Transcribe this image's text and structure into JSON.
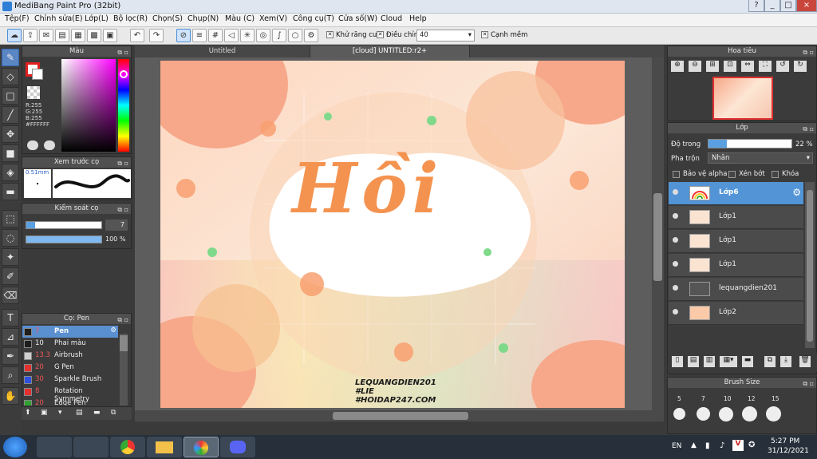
{
  "window": {
    "title": "MediBang Paint Pro (32bit)",
    "controls": [
      "?",
      "_",
      "□",
      "×"
    ]
  },
  "menu": [
    "Tệp(F)",
    "Chỉnh sửa(E)",
    "Lớp(L)",
    "Bộ lọc(R)",
    "Chọn(S)",
    "Chụp(N)",
    "Màu (C)",
    "Xem(V)",
    "Công cụ(T)",
    "Cửa số(W)",
    "Cloud",
    "Help"
  ],
  "toolbar": {
    "antialias_label": "Khử răng cưa",
    "correction_label": "Điều chỉnh",
    "correction_value": "40",
    "sharp_label": "Cạnh mềm"
  },
  "color_panel": {
    "title": "Màu",
    "r": "R:255",
    "g": "G:255",
    "b": "B:255",
    "hex": "#FFFFFF",
    "primary_color": "#e02020",
    "secondary_color": "#ffffff"
  },
  "brush_preview": {
    "title": "Xem trước cọ",
    "size": "0.51mm"
  },
  "brush_control": {
    "title": "Kiểm soát cọ",
    "size_value": "7",
    "opacity_value": "100 %"
  },
  "brush_list": {
    "title": "Cọ: Pen",
    "items": [
      {
        "size": "7",
        "name": "Pen",
        "color": "#1e1e1e"
      },
      {
        "size": "10",
        "name": "Phai màu",
        "color": "#1e1e1e"
      },
      {
        "size": "13.3",
        "name": "Airbrush",
        "color": "#cfcfcf"
      },
      {
        "size": "20",
        "name": "G Pen",
        "color": "#e03030"
      },
      {
        "size": "30",
        "name": "Sparkle Brush",
        "color": "#3050e0"
      },
      {
        "size": "8",
        "name": "Rotation Symmetry",
        "color": "#e03030"
      },
      {
        "size": "20",
        "name": "Edge Pen",
        "color": "#30a030"
      }
    ]
  },
  "tabs": [
    {
      "label": "Untitled"
    },
    {
      "label": "[cloud] UNTITLED:r2+"
    }
  ],
  "artwork": {
    "title_text": "Hồi",
    "watermark": [
      "LEQUANGDIEN201",
      "#LIE",
      "#HOIDAP247.COM"
    ]
  },
  "navigator": {
    "title": "Hoa tiêu"
  },
  "layers_panel": {
    "title": "Lớp",
    "opacity_label": "Độ trong",
    "opacity_value": "22 %",
    "opacity_fraction": 0.22,
    "blend_label": "Pha trộn",
    "blend_value": "Nhân",
    "protect_alpha": "Bảo vệ alpha",
    "clipping": "Xén bớt",
    "lock": "Khóa",
    "layers": [
      {
        "name": "Lớp6"
      },
      {
        "name": "Lớp1"
      },
      {
        "name": "Lớp1"
      },
      {
        "name": "Lớp1"
      },
      {
        "name": "lequangdien201"
      },
      {
        "name": "Lớp2"
      }
    ]
  },
  "brush_size_panel": {
    "title": "Brush Size",
    "sizes": [
      "5",
      "7",
      "10",
      "12",
      "15"
    ]
  },
  "taskbar": {
    "lang": "EN",
    "time": "5:27 PM",
    "date": "31/12/2021"
  }
}
